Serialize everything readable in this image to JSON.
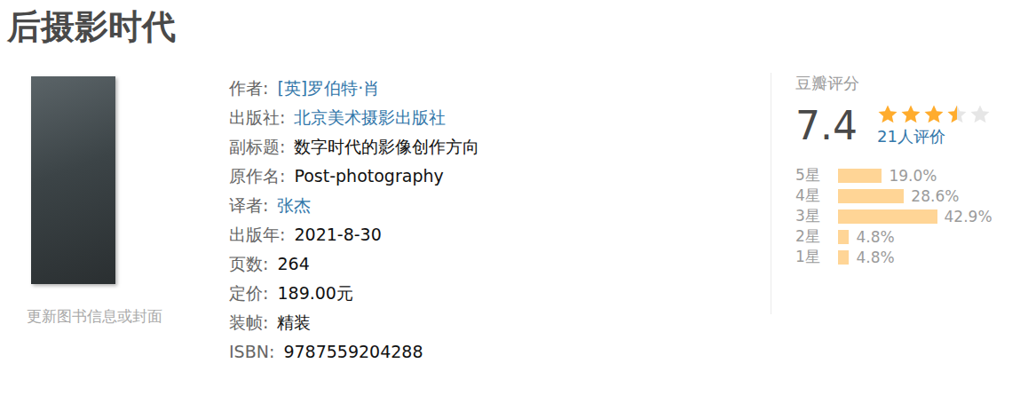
{
  "title": "后摄影时代",
  "cover": {
    "caption": "更新图书信息或封面"
  },
  "info": [
    {
      "label": "作者:",
      "value": "[英]罗伯特·肖",
      "kind": "link"
    },
    {
      "label": "出版社:",
      "value": "北京美术摄影出版社",
      "kind": "link"
    },
    {
      "label": "副标题:",
      "value": "数字时代的影像创作方向",
      "kind": "text"
    },
    {
      "label": "原作名:",
      "value": "Post-photography",
      "kind": "text"
    },
    {
      "label": "译者:",
      "value": "张杰",
      "kind": "link"
    },
    {
      "label": "出版年:",
      "value": "2021-8-30",
      "kind": "text"
    },
    {
      "label": "页数:",
      "value": "264",
      "kind": "text"
    },
    {
      "label": "定价:",
      "value": "189.00元",
      "kind": "text"
    },
    {
      "label": "装帧:",
      "value": "精装",
      "kind": "text"
    },
    {
      "label": "ISBN:",
      "value": "9787559204288",
      "kind": "text"
    }
  ],
  "rating": {
    "heading": "豆瓣评分",
    "score": "7.4",
    "stars": 3.5,
    "count": "21人评价",
    "bars": [
      {
        "label": "5星",
        "percent": "19.0%",
        "level": 0.19
      },
      {
        "label": "4星",
        "percent": "28.6%",
        "level": 0.286
      },
      {
        "label": "3星",
        "percent": "42.9%",
        "level": 0.429
      },
      {
        "label": "2星",
        "percent": "4.8%",
        "level": 0.048
      },
      {
        "label": "1星",
        "percent": "4.8%",
        "level": 0.048
      }
    ]
  }
}
